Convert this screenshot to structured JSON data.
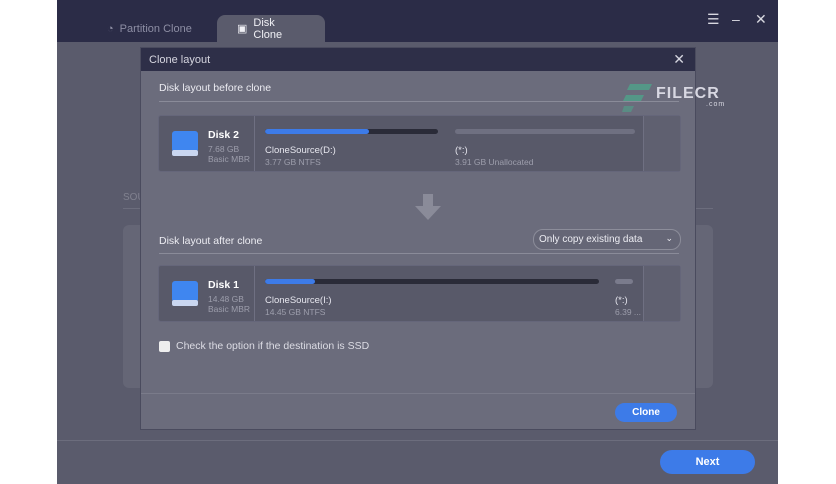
{
  "tabs": [
    {
      "label": "Partition Clone",
      "active": false
    },
    {
      "label": "Disk Clone",
      "active": true
    }
  ],
  "window_controls": {
    "menu": "☰",
    "minimize": "–",
    "close": "✕"
  },
  "background": {
    "section_label": "SOU"
  },
  "footer": {
    "next_label": "Next"
  },
  "modal": {
    "title": "Clone layout",
    "close": "✕",
    "before_label": "Disk layout before clone",
    "after_label": "Disk layout after clone",
    "copy_option": "Only copy existing data",
    "ssd_label": "Check the option if the destination is SSD",
    "ssd_checked": false,
    "clone_label": "Clone",
    "before_disk": {
      "name": "Disk 2",
      "size": "7.68 GB",
      "type": "Basic MBR",
      "partitions": [
        {
          "name": "CloneSource(D:)",
          "detail": "3.77 GB NTFS",
          "used_fraction": 0.6
        },
        {
          "name": "(*:)",
          "detail": "3.91 GB Unallocated",
          "used_fraction": 0
        }
      ]
    },
    "after_disk": {
      "name": "Disk 1",
      "size": "14.48 GB",
      "type": "Basic MBR",
      "partitions": [
        {
          "name": "CloneSource(I:)",
          "detail": "14.45 GB NTFS",
          "used_fraction": 0.15
        },
        {
          "name": "(*:)",
          "detail": "6.39 ...",
          "used_fraction": 0
        }
      ]
    }
  },
  "watermark": {
    "text": "FILECR",
    "suffix": ".com"
  },
  "colors": {
    "accent": "#3d7be8",
    "titlebar": "#2b2c47"
  }
}
